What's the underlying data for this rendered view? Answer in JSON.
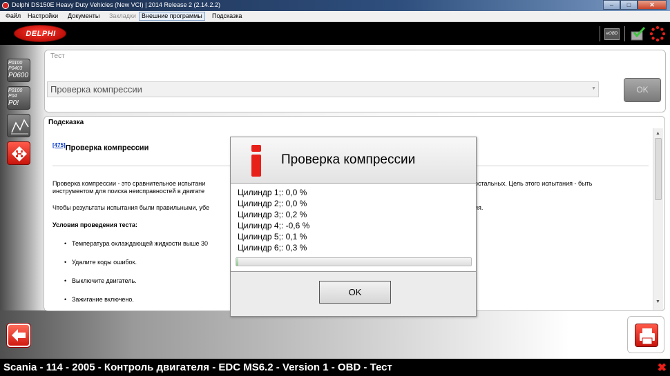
{
  "window": {
    "title": "Delphi DS150E Heavy Duty Vehicles (New VCI) | 2014 Release 2 (2.14.2.2)",
    "minimize": "–",
    "maximize": "□",
    "close": "✕"
  },
  "menu": {
    "file": "Файл",
    "settings": "Настройки",
    "documents": "Документы",
    "bookmarks": "Закладки",
    "external": "Внешние программы",
    "help": "Подсказка"
  },
  "header": {
    "logo": "DELPHI",
    "eobd": "eOBD"
  },
  "sidebar": {
    "codes1": [
      "P0100",
      "P0403",
      "P0600"
    ],
    "codes2": [
      "P0100",
      "P04",
      "P0!"
    ]
  },
  "test_panel": {
    "label": "Тест",
    "selected": "Проверка компрессии",
    "ok": "OK"
  },
  "help_panel": {
    "tab": "Подсказка",
    "ref": "[475]",
    "heading": "Проверка компрессии",
    "p1_left": "Проверка компрессии - это сравнительное испытани",
    "p1_right": "остальных. Цель этого испытания - быть",
    "p1b_left": "инструментом для поиска неисправностей в двигате",
    "p2_left": "Чтобы результаты испытания были правильными, убе",
    "p2_right": "ия.",
    "conditions": "Условия проведения теста:",
    "bullets": [
      "Температура охлаждающей жидкости выше 30",
      "Удалите коды ошибок.",
      "Выключите двигатель.",
      "Зажигание включено."
    ]
  },
  "dialog": {
    "title": "Проверка компрессии",
    "cylinders": [
      "Цилиндр 1;: 0,0 %",
      "Цилиндр 2;: 0,0 %",
      "Цилиндр 3;: 0,2 %",
      "Цилиндр 4;: -0,6 %",
      "Цилиндр 5;: 0,1 %",
      "Цилиндр 6;: 0,3 %"
    ],
    "progress_percent": 1,
    "ok": "OK"
  },
  "status": {
    "text": "Scania - 114 - 2005 - Контроль двигателя - EDC MS6.2 - Version 1 - OBD - Тест",
    "close": "✖"
  },
  "colors": {
    "accent_red": "#d01a10",
    "header_black": "#000000"
  }
}
